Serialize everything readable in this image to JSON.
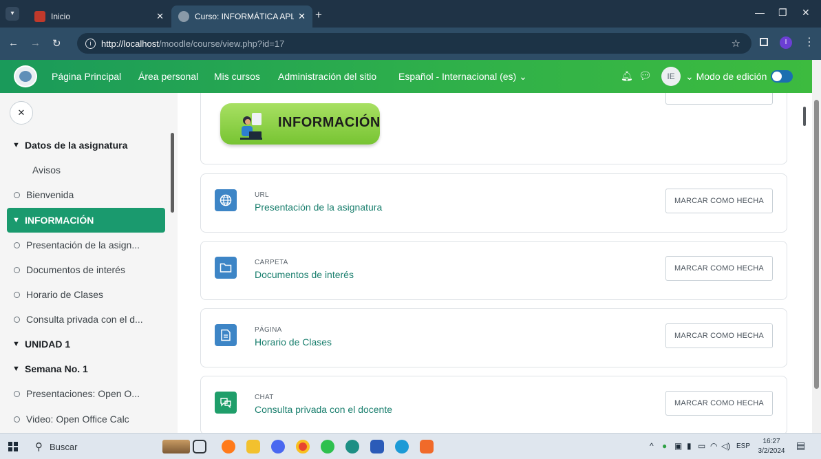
{
  "browser": {
    "tabs": [
      {
        "title": "Inicio"
      },
      {
        "title": "Curso: INFORMÁTICA APLICADA"
      }
    ],
    "url_host": "http://localhost",
    "url_path": "/moodle/course/view.php?id=17",
    "profile_initial": "I"
  },
  "navbar": {
    "links": [
      "Página Principal",
      "Área personal",
      "Mis cursos",
      "Administración del sitio",
      "Español - Internacional (es) ⌄"
    ],
    "avatar_initials": "IE",
    "edit_mode_label": "⌄  Modo de edición"
  },
  "course_index": {
    "items": [
      {
        "label": "Datos de la asignatura",
        "kind": "section"
      },
      {
        "label": "Avisos",
        "kind": "plain"
      },
      {
        "label": "Bienvenida",
        "kind": "activity"
      },
      {
        "label": "INFORMACIÓN",
        "kind": "section-active"
      },
      {
        "label": "Presentación de la asign...",
        "kind": "activity"
      },
      {
        "label": "Documentos de interés",
        "kind": "activity"
      },
      {
        "label": "Horario de Clases",
        "kind": "activity"
      },
      {
        "label": "Consulta privada con el d...",
        "kind": "activity"
      },
      {
        "label": "UNIDAD 1",
        "kind": "section"
      },
      {
        "label": "Semana No. 1",
        "kind": "section"
      },
      {
        "label": "Presentaciones: Open O...",
        "kind": "activity"
      },
      {
        "label": "Video: Open Office Calc",
        "kind": "activity"
      }
    ]
  },
  "main": {
    "banner_text": "INFORMACIÓN",
    "mark_done_label": "MARCAR COMO HECHA",
    "activities": [
      {
        "type": "URL",
        "name": "Presentación de la asignatura",
        "icon": "globe-icon",
        "color": "#3d85c6"
      },
      {
        "type": "CARPETA",
        "name": "Documentos de interés",
        "icon": "folder-icon",
        "color": "#3d85c6"
      },
      {
        "type": "PÁGINA",
        "name": "Horario de Clases",
        "icon": "page-icon",
        "color": "#3d85c6"
      },
      {
        "type": "CHAT",
        "name": "Consulta privada con el docente",
        "icon": "chat-icon",
        "color": "#1f9e6a"
      }
    ]
  },
  "taskbar": {
    "search_label": "Buscar",
    "language": "ESP",
    "time": "16:27",
    "date": "3/2/2024"
  }
}
